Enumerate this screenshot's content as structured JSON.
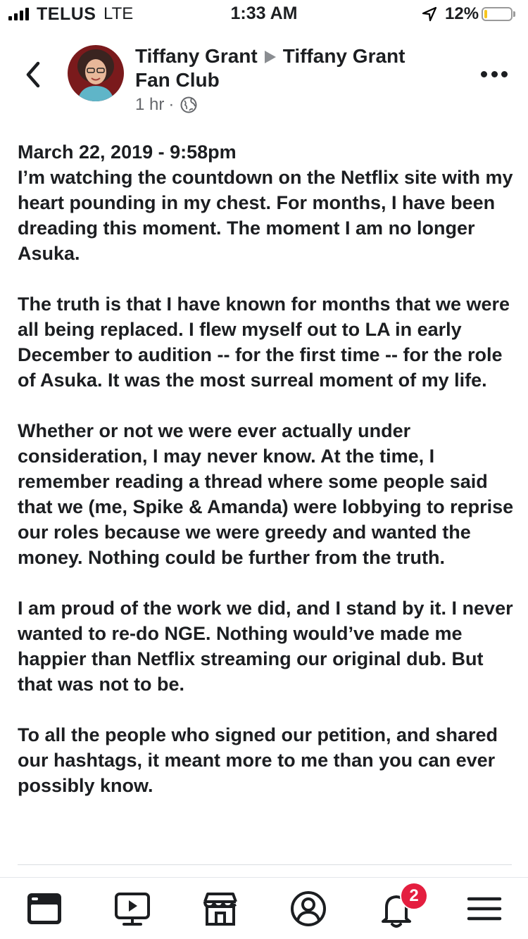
{
  "status_bar": {
    "carrier": "TELUS",
    "network": "LTE",
    "time": "1:33 AM",
    "battery_text": "12%",
    "battery_level": 0.12,
    "battery_color": "#f7c61f"
  },
  "header": {
    "author": "Tiffany Grant",
    "group": "Tiffany Grant Fan Club",
    "time_ago": "1 hr",
    "separator": "·",
    "privacy_icon": "globe-icon"
  },
  "post": {
    "paragraphs": [
      "March 22, 2019 - 9:58pm\nI’m watching the countdown on the Netflix site with my heart pounding in my chest. For months, I have been dreading this moment. The moment I am no longer Asuka.",
      "The truth is that I have known for months that we were all being replaced.  I flew myself out to LA in early December to audition -- for the first time -- for the role of Asuka. It was the most surreal moment of my life.",
      "Whether or not we were ever actually under consideration, I may never know.  At the time, I remember reading a thread where some people said that we (me, Spike & Amanda) were lobbying to reprise our roles because we were greedy and wanted the money. Nothing could be further from the truth.",
      "I am proud of the work we did, and I stand by it.  I never wanted to re-do NGE.  Nothing would’ve made me happier than Netflix streaming our original dub.  But that was not to be.",
      "To all the people who signed our petition, and shared our hashtags, it meant more to me than you can ever possibly know."
    ]
  },
  "bottom_nav": {
    "items": [
      "news-feed-icon",
      "watch-icon",
      "marketplace-icon",
      "profile-icon",
      "notifications-icon",
      "menu-icon"
    ],
    "notification_count": "2",
    "badge_color": "#e41e3f"
  }
}
